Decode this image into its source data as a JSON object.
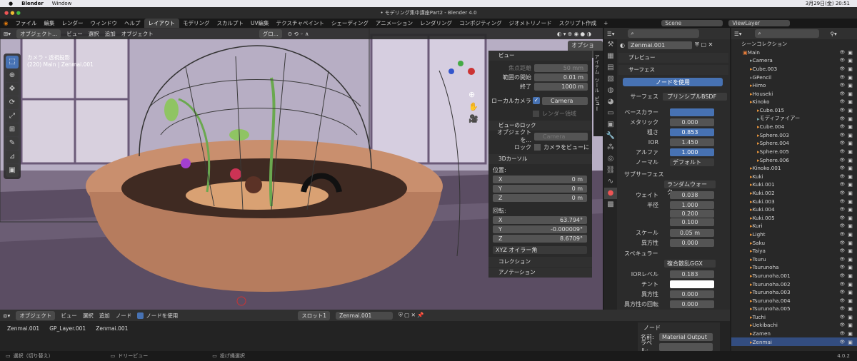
{
  "mac_menu": {
    "app": "Blender",
    "window": "Window",
    "datetime": "3月29日(金) 20:51"
  },
  "title": "• モデリング集中講座Part2 - Blender 4.0",
  "menu": [
    "ファイル",
    "編集",
    "レンダー",
    "ウィンドウ",
    "ヘルプ"
  ],
  "workspaces": [
    "レイアウト",
    "モデリング",
    "スカルプト",
    "UV編集",
    "テクスチャペイント",
    "シェーディング",
    "アニメーション",
    "レンダリング",
    "コンポジティング",
    "ジオメトリノード",
    "スクリプト作成"
  ],
  "scene": "Scene",
  "view_layer": "ViewLayer",
  "vp_header": {
    "mode": "オブジェクト...",
    "items": [
      "ビュー",
      "選択",
      "追加",
      "オブジェクト"
    ],
    "orient": "グロ...",
    "options": "オプション"
  },
  "vp_overlay": {
    "line1": "カメラ・透視投影",
    "line2": "(220) Main | Zenmai.001"
  },
  "side_tabs": [
    "アイテム",
    "ツール",
    "ビュー"
  ],
  "npanel": {
    "view_title": "ビュー",
    "focal_label": "焦点距離",
    "focal": "50 mm",
    "clip_start_label": "範囲の開始",
    "clip_start": "0.01 m",
    "clip_end_label": "終了",
    "clip_end": "1000 m",
    "local_cam": "ローカルカメラ",
    "camera": "Camera",
    "render_region": "レンダー領域",
    "lock_title": "ビューのロック",
    "lock_obj": "オブジェクトを...",
    "lock_cam": "Camera",
    "lock": "ロック",
    "cam_to_view": "カメラをビューに",
    "cursor_title": "3Dカーソル",
    "loc": "位置:",
    "x": "X",
    "y": "Y",
    "z": "Z",
    "loc_val": "0 m",
    "rot": "回転:",
    "rx": "63.794°",
    "ry": "-0.000009°",
    "rz": "8.6709°",
    "mode": "XYZ オイラー角",
    "coll": "コレクション",
    "anno": "アノテーション"
  },
  "props": {
    "obj": "Zenmai.001",
    "preview": "プレビュー",
    "surface": "サーフェス",
    "use_nodes": "ノードを使用",
    "surface_lbl": "サーフェス",
    "bsdf": "プリンシプルBSDF",
    "rows": [
      {
        "l": "ベースカラー",
        "v": ""
      },
      {
        "l": "メタリック",
        "v": "0.000"
      },
      {
        "l": "粗さ",
        "v": "0.853"
      },
      {
        "l": "IOR",
        "v": "1.450"
      },
      {
        "l": "アルファ",
        "v": "1.000"
      },
      {
        "l": "ノーマル",
        "v": "デフォルト"
      }
    ],
    "sss": "サブサーフェス",
    "sss_method": "ランダムウォーク",
    "weight_l": "ウェイト",
    "weight": "0.038",
    "radius_l": "半径",
    "r1": "1.000",
    "r2": "0.200",
    "r3": "0.100",
    "scale_l": "スケール",
    "scale": "0.05 m",
    "aniso_l": "異方性",
    "aniso": "0.000",
    "spec": "スペキュラー",
    "spec_dist": "複合散乱GGX",
    "ior_lvl_l": "IORレベル",
    "ior_lvl": "0.183",
    "tint_l": "チント",
    "aniso2_l": "異方性",
    "aniso2": "0.000",
    "aniso_rot_l": "異方性の回転",
    "aniso_rot": "0.000"
  },
  "outliner": {
    "title": "シーンコレクション",
    "items": [
      {
        "n": "Main",
        "d": 0,
        "c": "#e07a3a"
      },
      {
        "n": "Camera",
        "d": 1,
        "c": "#9aa"
      },
      {
        "n": "Cube.003",
        "d": 1,
        "c": "#e8953c"
      },
      {
        "n": "GPencil",
        "d": 1,
        "c": "#777"
      },
      {
        "n": "Himo",
        "d": 1,
        "c": "#e8953c"
      },
      {
        "n": "Houseki",
        "d": 1,
        "c": "#e8953c"
      },
      {
        "n": "Kinoko",
        "d": 1,
        "c": "#e8953c"
      },
      {
        "n": "Cube.015",
        "d": 2,
        "c": "#e8953c"
      },
      {
        "n": "モディファイアー",
        "d": 2,
        "c": "#7aa"
      },
      {
        "n": "Cube.004",
        "d": 2,
        "c": "#e8953c"
      },
      {
        "n": "Sphere.003",
        "d": 2,
        "c": "#e8953c"
      },
      {
        "n": "Sphere.004",
        "d": 2,
        "c": "#e8953c"
      },
      {
        "n": "Sphere.005",
        "d": 2,
        "c": "#e8953c"
      },
      {
        "n": "Sphere.006",
        "d": 2,
        "c": "#e8953c"
      },
      {
        "n": "Kinoko.001",
        "d": 1,
        "c": "#e8953c"
      },
      {
        "n": "Kuki",
        "d": 1,
        "c": "#e8953c"
      },
      {
        "n": "Kuki.001",
        "d": 1,
        "c": "#e8953c"
      },
      {
        "n": "Kuki.002",
        "d": 1,
        "c": "#e8953c"
      },
      {
        "n": "Kuki.003",
        "d": 1,
        "c": "#e8953c"
      },
      {
        "n": "Kuki.004",
        "d": 1,
        "c": "#e8953c"
      },
      {
        "n": "Kuki.005",
        "d": 1,
        "c": "#e8953c"
      },
      {
        "n": "Kuri",
        "d": 1,
        "c": "#e8953c"
      },
      {
        "n": "Light",
        "d": 1,
        "c": "#e8953c"
      },
      {
        "n": "Saku",
        "d": 1,
        "c": "#e8953c"
      },
      {
        "n": "Taiya",
        "d": 1,
        "c": "#e8953c"
      },
      {
        "n": "Tsuru",
        "d": 1,
        "c": "#e8953c"
      },
      {
        "n": "Tsurunoha",
        "d": 1,
        "c": "#e8953c"
      },
      {
        "n": "Tsurunoha.001",
        "d": 1,
        "c": "#e8953c"
      },
      {
        "n": "Tsurunoha.002",
        "d": 1,
        "c": "#e8953c"
      },
      {
        "n": "Tsurunoha.003",
        "d": 1,
        "c": "#e8953c"
      },
      {
        "n": "Tsurunoha.004",
        "d": 1,
        "c": "#e8953c"
      },
      {
        "n": "Tsurunoha.005",
        "d": 1,
        "c": "#e8953c"
      },
      {
        "n": "Tuchi",
        "d": 1,
        "c": "#e8953c"
      },
      {
        "n": "Uekibachi",
        "d": 1,
        "c": "#e8953c"
      },
      {
        "n": "Zamen",
        "d": 1,
        "c": "#e8953c"
      },
      {
        "n": "Zenmai",
        "d": 1,
        "c": "#e8953c"
      }
    ]
  },
  "node_header": {
    "mode": "オブジェクト",
    "items": [
      "ビュー",
      "選択",
      "追加",
      "ノード"
    ],
    "use_nodes": "ノードを使用",
    "slot": "スロット1",
    "material": "Zenmai.001"
  },
  "breadcrumb": [
    "Zenmai.001",
    "GP_Layer.001",
    "Zenmai.001"
  ],
  "node_panel": {
    "title": "ノード",
    "name_l": "名前:",
    "name": "Material Output",
    "label_l": "ラベル:"
  },
  "status": {
    "select": "選択（切り替え）",
    "dolly": "ドリービュー",
    "lasso": "投げ縄選択",
    "version": "4.0.2"
  }
}
